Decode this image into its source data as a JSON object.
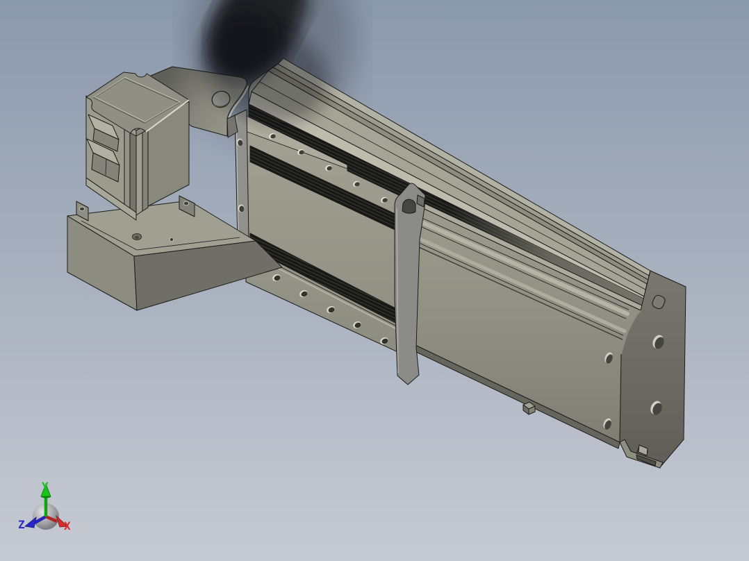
{
  "app": {
    "name": "cad-3d-viewport",
    "description": "CAD viewport with 3D model of a belt-driven linear actuator slide with stepper motor"
  },
  "scene": {
    "background": {
      "top": "#8B99AC",
      "mid": "#A9B1BF",
      "bottom": "#C6CAD3"
    },
    "shadow_color": "#121216",
    "model": {
      "palette": {
        "edge": "#1B1B18",
        "top_light": "#B2B2A4",
        "top": "#A5A597",
        "top_mid": "#9C9C8E",
        "front_light": "#9D9D8F",
        "front": "#8F8F81",
        "side": "#73736B",
        "dark": "#6F6F67",
        "end_cap": "#72726A",
        "rib": "#BDBDAF",
        "belt": "#181816",
        "belt_line": "#4E4E46",
        "bracket": "#8B8B87",
        "hole": "#44443E",
        "highlight": "#D8D8CC",
        "motor_top": "#8F8F85",
        "motor_left": "#9C9C8E",
        "motor_right": "#88887C",
        "base_top": "#A0A092",
        "base_left": "#8C8C80",
        "base_right": "#6F6F67",
        "plate": "#9A9A8C"
      }
    },
    "triad": {
      "hub_color": "#A8A8AC",
      "axes": [
        {
          "label": "X",
          "color": "#D62C2C"
        },
        {
          "label": "Y",
          "color": "#17C417"
        },
        {
          "label": "Z",
          "color": "#2A2ACC"
        }
      ]
    }
  }
}
